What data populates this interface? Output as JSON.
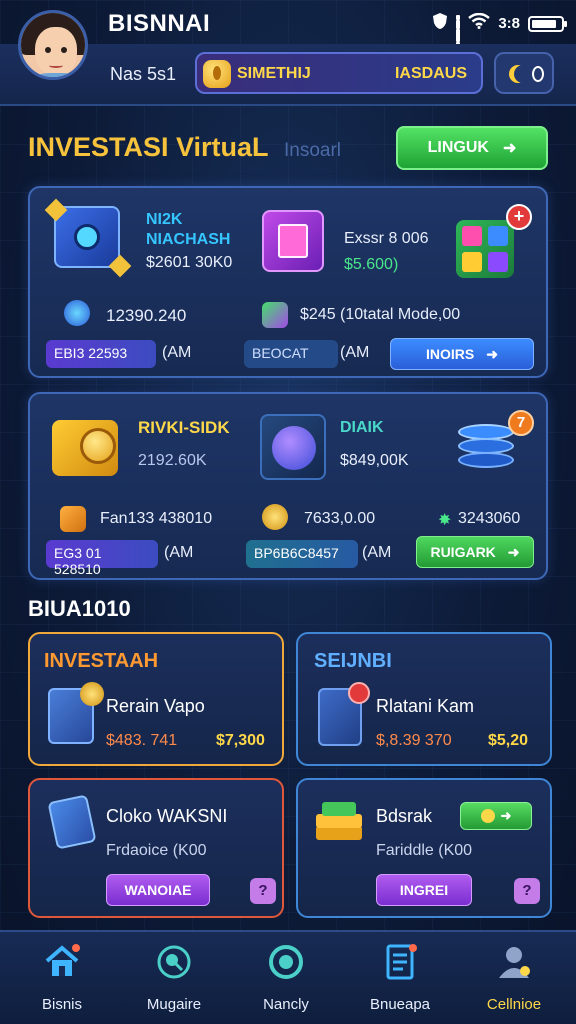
{
  "status_bar": {
    "app_name": "BISNNAI",
    "time": "3:8"
  },
  "header": {
    "user_name": "Nas 5s1",
    "balance_label": "SIMETHIJ",
    "balance_value": "IASDAUS"
  },
  "section": {
    "title": "INVESTASI VirtuaL",
    "subtitle": "Insoarl",
    "action_label": "LINGUK"
  },
  "panel1": {
    "item1": {
      "name": "NI2K NIACHASH",
      "value": "$2601 30K0"
    },
    "item2": {
      "name": "Exssr 8 006",
      "value": "$5.600)"
    },
    "stat1": "12390.240",
    "stat2": "$245 (10tatal Mode,00",
    "chip1": "EBI3 22593",
    "chip1_suffix": "(AM",
    "chip2": "BEOCAT",
    "chip2_suffix": "(AM",
    "button": "INOIRS"
  },
  "panel2": {
    "item1": {
      "name": "RIVKI-SIDK",
      "value": "2192.60K"
    },
    "item2": {
      "name": "DIAIK",
      "value": "$849,00K"
    },
    "badge": "7",
    "stat1": "Fan133 438010",
    "stat2": "7633,0.00",
    "stat3": "3243060",
    "chip1": "EG3 01 528510",
    "chip1_suffix": "(AM",
    "chip2": "BP6B6C8457",
    "chip2_suffix": "(AM",
    "button": "RUIGARK"
  },
  "bottom_section": {
    "title": "BIUA1010",
    "card_a": {
      "title": "INVESTAAH",
      "name": "Rerain Vapo",
      "value_left": "$483. 741",
      "value_right": "$7,300"
    },
    "card_b": {
      "title": "SEIJNBI",
      "name": "Rlatani Kam",
      "value_left": "$,8.39 370",
      "value_right": "$5,20"
    },
    "card_c": {
      "name": "Cloko WAKSNI",
      "sub": "Frdaoice (K00",
      "button": "WANOIAE",
      "help": "?"
    },
    "card_d": {
      "name": "Bdsrak",
      "sub": "Fariddle (K00",
      "button": "INGREI",
      "help": "?"
    }
  },
  "nav": {
    "items": [
      {
        "label": "Bisnis"
      },
      {
        "label": "Mugaire"
      },
      {
        "label": "Nancly"
      },
      {
        "label": "Bnueapa"
      },
      {
        "label": "Cellnioe"
      }
    ]
  },
  "colors": {
    "accent_yellow": "#ffd84a",
    "accent_green": "#3bc94a",
    "accent_blue": "#3c8cff",
    "panel_border": "#3e67b8",
    "background": "#0d1b38"
  }
}
